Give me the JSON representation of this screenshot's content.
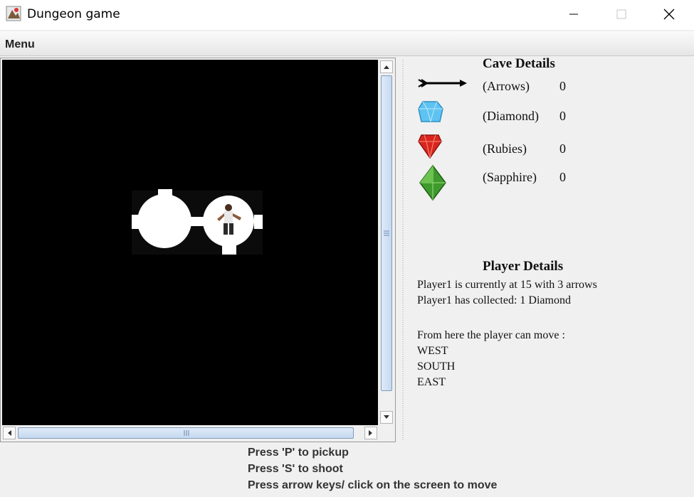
{
  "window": {
    "title": "Dungeon game"
  },
  "menu": {
    "label": "Menu"
  },
  "cave_details": {
    "heading": "Cave Details",
    "items": [
      {
        "label": "(Arrows)",
        "count": "0",
        "icon": "arrow-icon"
      },
      {
        "label": "(Diamond)",
        "count": "0",
        "icon": "diamond-icon"
      },
      {
        "label": "(Rubies)",
        "count": "0",
        "icon": "ruby-icon"
      },
      {
        "label": "(Sapphire)",
        "count": "0",
        "icon": "sapphire-icon"
      }
    ]
  },
  "player_details": {
    "heading": "Player Details",
    "location_line": "Player1 is currently at 15 with 3 arrows",
    "collected_line": "Player1 has collected: 1 Diamond",
    "moves_heading": "From here the player can move :",
    "moves": [
      "WEST",
      "SOUTH",
      "EAST"
    ]
  },
  "instructions": [
    "Press 'P' to pickup",
    "Press 'S' to shoot",
    "Press arrow keys/ click on the screen to move"
  ],
  "colors": {
    "canvas_bg": "#000000",
    "cave": "#ffffff",
    "panel_bg": "#f0f0f0"
  }
}
